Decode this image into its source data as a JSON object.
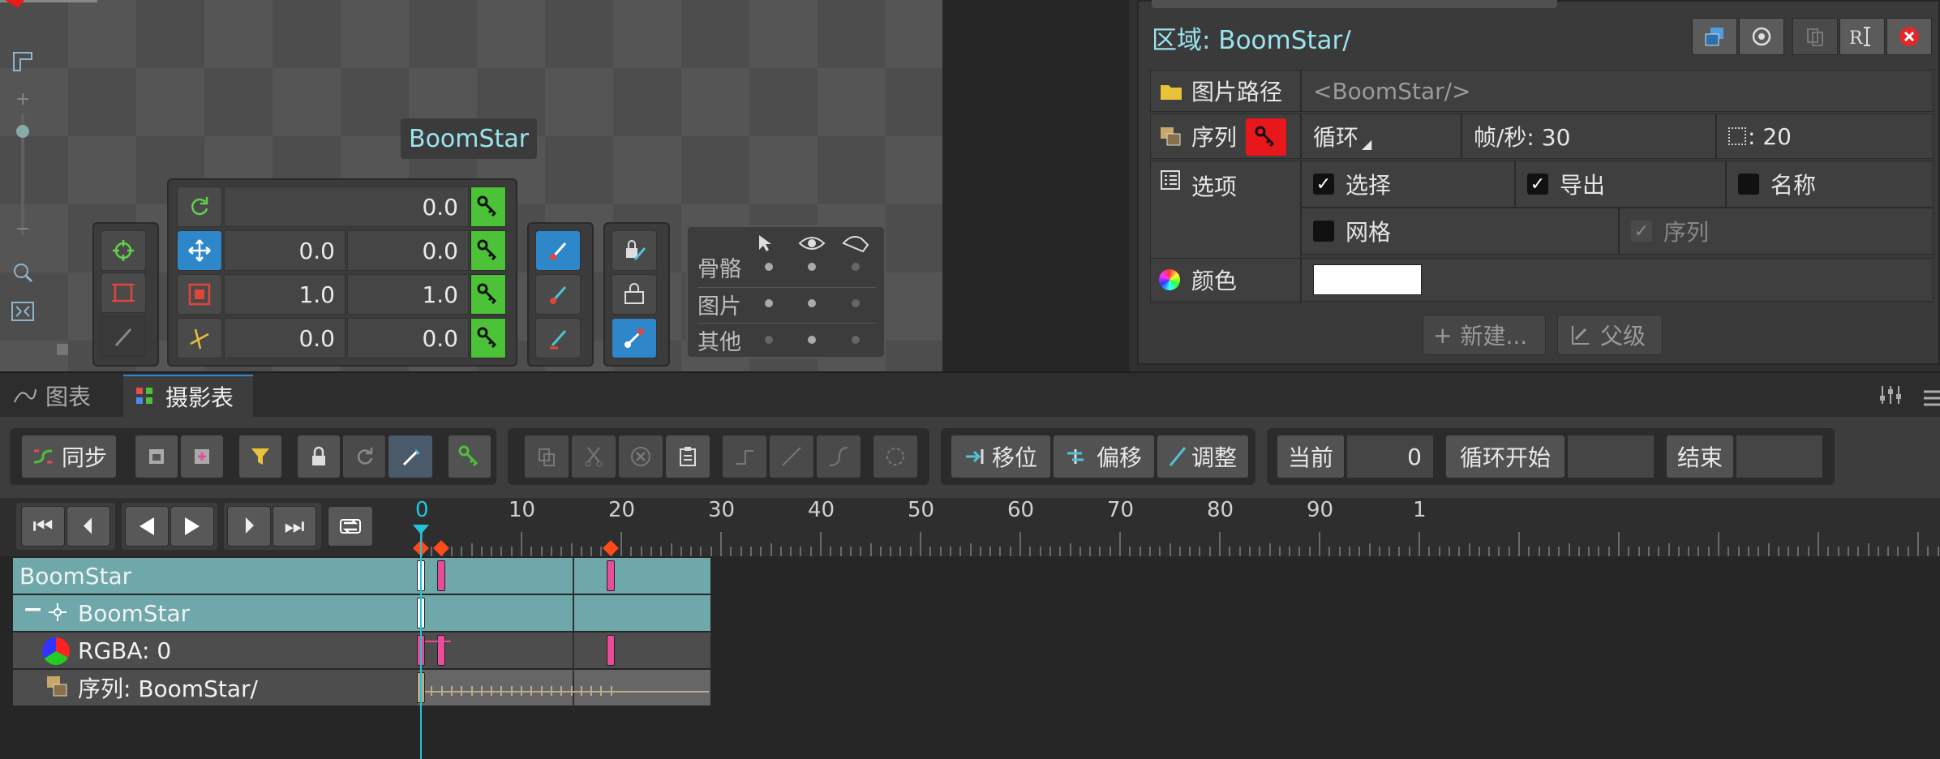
{
  "viewport": {
    "sprite_label": "BoomStar",
    "transform_rows": [
      {
        "icon": "rotate-icon",
        "v1": "0.0",
        "v2": ""
      },
      {
        "icon": "move-icon",
        "v1": "0.0",
        "v2": "0.0"
      },
      {
        "icon": "scale-icon",
        "v1": "1.0",
        "v2": "1.0"
      },
      {
        "icon": "shear-icon",
        "v1": "0.0",
        "v2": "0.0"
      }
    ],
    "zoom_plus": "+",
    "zoom_minus": "−",
    "visibility_rows": [
      "骨骼",
      "图片",
      "其他"
    ]
  },
  "props": {
    "region_title": "区域: BoomStar/",
    "path_label": "图片路径",
    "path_value": "<BoomStar/>",
    "seq_label": "序列",
    "loop_label": "循环",
    "fps_label": "帧/秒: 30",
    "frames_label": ": 20",
    "options_label": "选项",
    "opt_select": "选择",
    "opt_export": "导出",
    "opt_name": "名称",
    "opt_grid": "网格",
    "opt_seq": "序列",
    "color_label": "颜色",
    "color_value": "#ffffff",
    "new_btn": "新建...",
    "parent_btn": "父级"
  },
  "tabs": {
    "graph": "图表",
    "dopesheet": "摄影表"
  },
  "toolbar": {
    "sync": "同步",
    "move": "移位",
    "offset": "偏移",
    "adjust": "调整",
    "current_label": "当前",
    "current_value": "0",
    "loop_start_label": "循环开始",
    "loop_start_value": "",
    "end_label": "结束",
    "end_value": ""
  },
  "timeline": {
    "ruler_numbers": [
      "0",
      "10",
      "20",
      "30",
      "40",
      "50",
      "60",
      "70",
      "80",
      "90",
      "1"
    ],
    "rows": [
      {
        "label": "BoomStar"
      },
      {
        "label": "BoomStar"
      },
      {
        "label": "RGBA: 0"
      },
      {
        "label": "序列: BoomStar/"
      }
    ],
    "current_frame": 0
  },
  "colors": {
    "accent": "#2e87c9",
    "key": "#4cc238",
    "track": "#6fa8aa",
    "keyframe": "#e84c9b",
    "cursor": "#21c4d6"
  }
}
